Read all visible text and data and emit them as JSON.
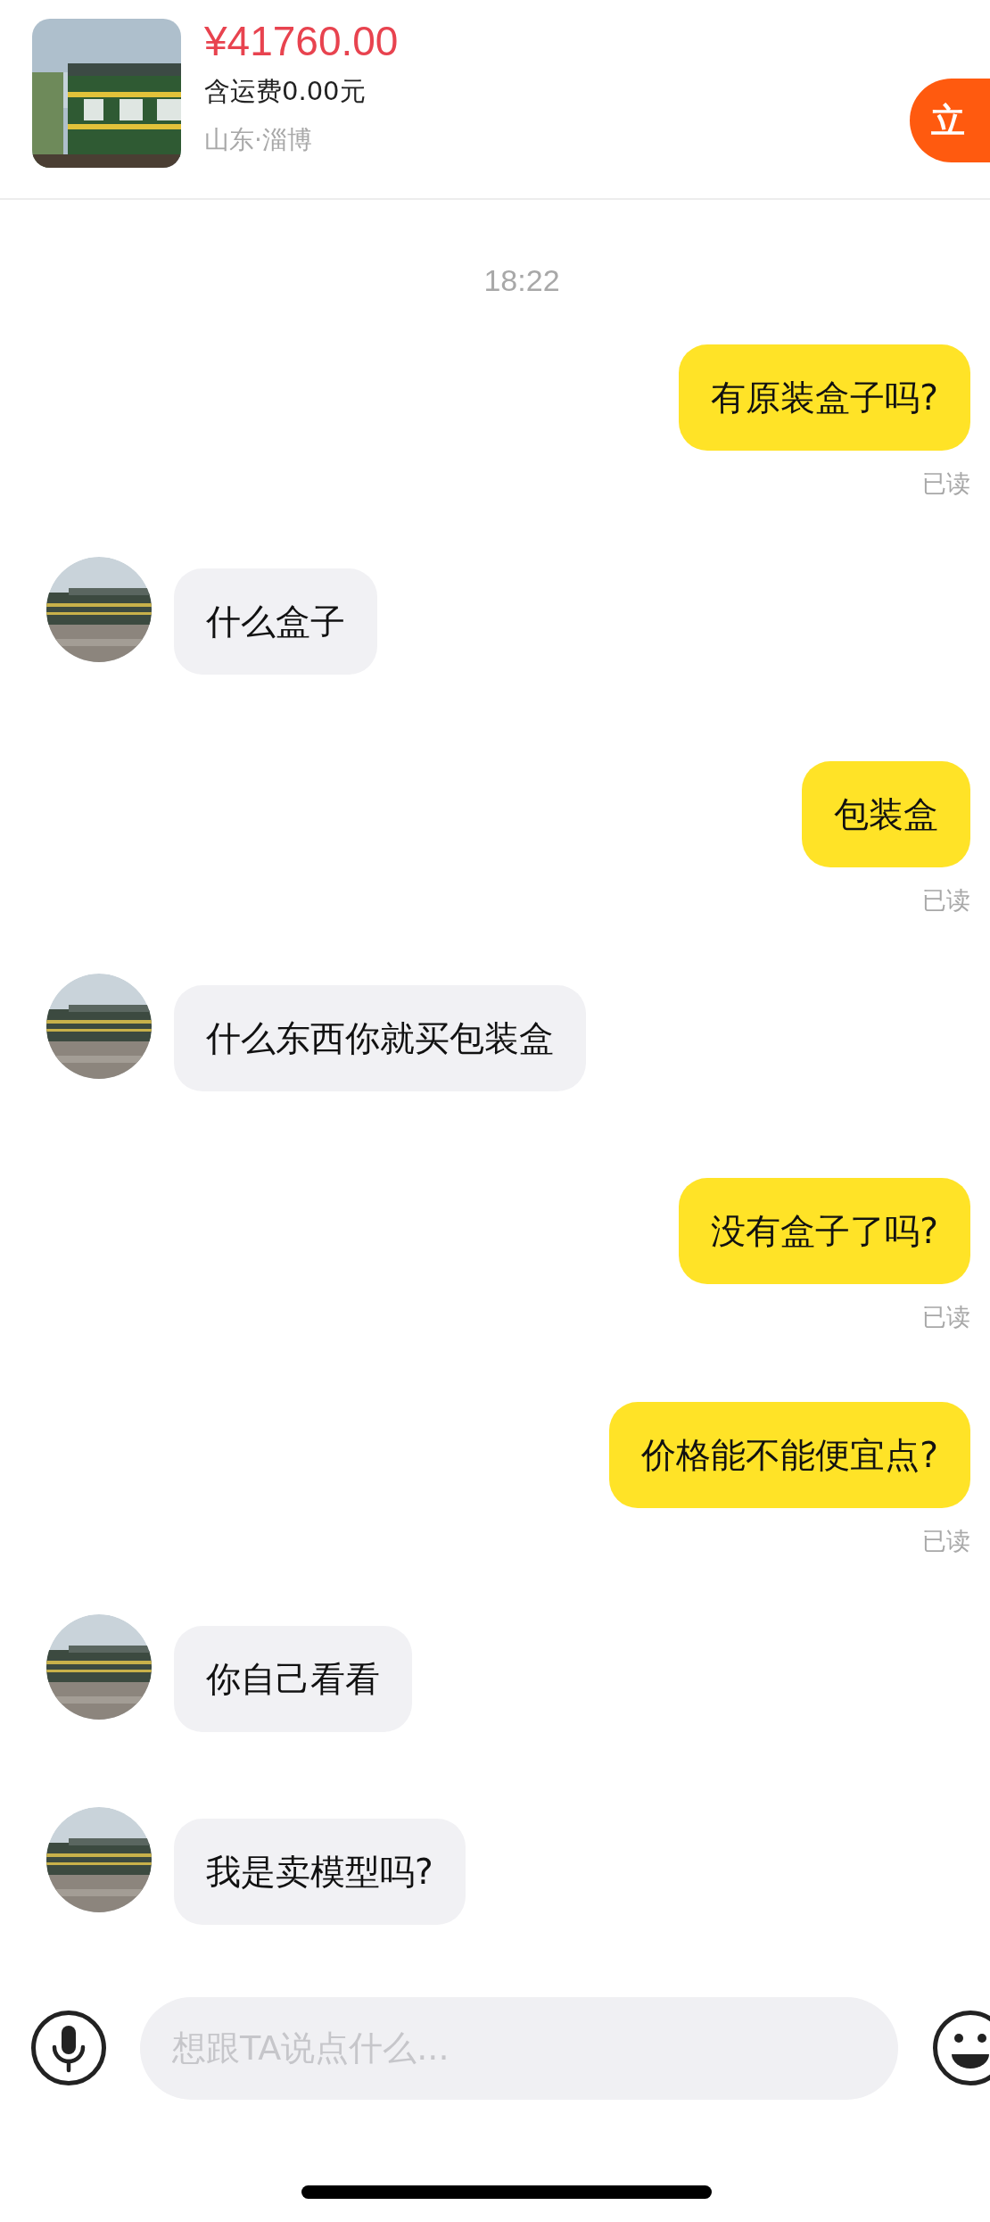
{
  "product": {
    "price": "¥41760.00",
    "shipping": "含运费0.00元",
    "location": "山东·淄博",
    "buy_button": "立"
  },
  "time": "18:22",
  "messages": [
    {
      "kind": "sent",
      "text": "有原装盒子吗?",
      "read_label": "已读"
    },
    {
      "kind": "received",
      "text": "什么盒子"
    },
    {
      "kind": "sent",
      "text": "包装盒",
      "read_label": "已读"
    },
    {
      "kind": "received",
      "text": "什么东西你就买包装盒"
    },
    {
      "kind": "sent",
      "text": "没有盒子了吗?",
      "read_label": "已读"
    },
    {
      "kind": "sent",
      "text": "价格能不能便宜点?",
      "read_label": "已读"
    },
    {
      "kind": "received",
      "text": "你自己看看"
    },
    {
      "kind": "received",
      "text": "我是卖模型吗?"
    }
  ],
  "input": {
    "placeholder": "想跟TA说点什么..."
  }
}
